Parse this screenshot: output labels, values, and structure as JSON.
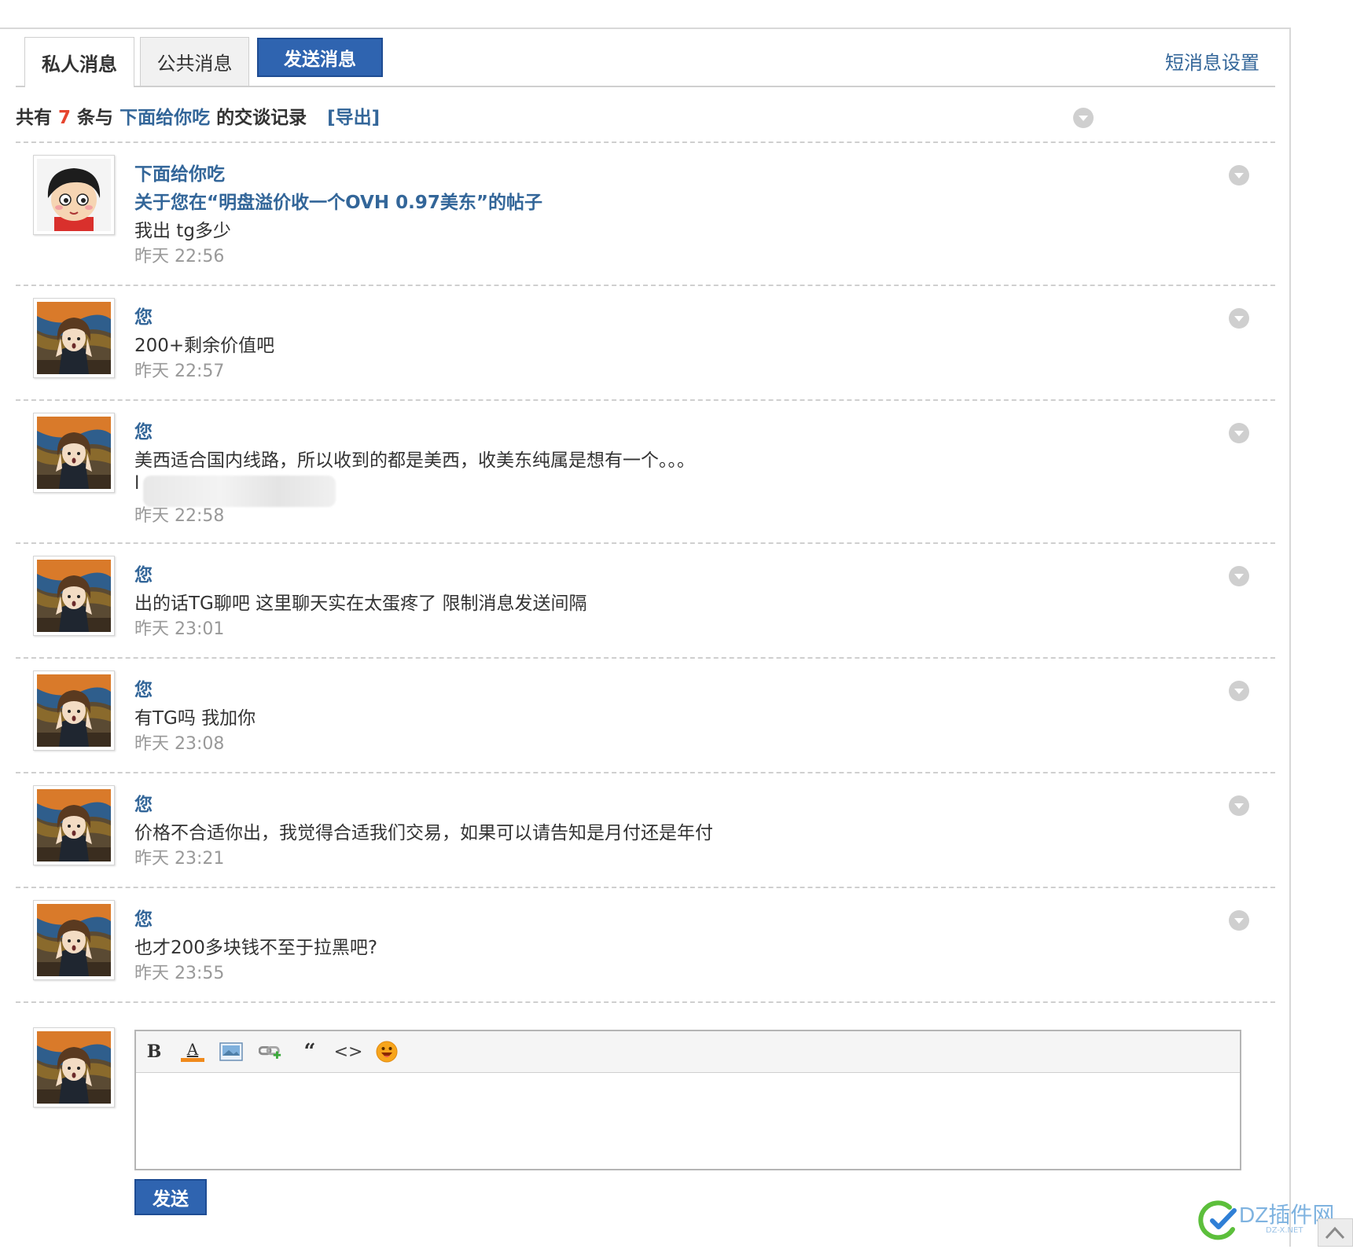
{
  "tabs": {
    "private": "私人消息",
    "public": "公共消息",
    "send_message": "发送消息",
    "settings": "短消息设置"
  },
  "summary": {
    "prefix": "共有",
    "count": "7",
    "middle": "条与",
    "peer": "下面给你吃",
    "suffix": "的交谈记录",
    "export": "[导出]"
  },
  "messages": [
    {
      "author": "下面给你吃",
      "subject": "关于您在“明盘溢价收一个OVH 0.97美东”的帖子",
      "text": "我出 tg多少",
      "time": "昨天 22:56",
      "avatar": "peer"
    },
    {
      "author": "您",
      "text": "200+剩余价值吧",
      "time": "昨天 22:57",
      "avatar": "self"
    },
    {
      "author": "您",
      "text": "美西适合国内线路，所以收到的都是美西，收美东纯属是想有一个。。。",
      "text2": "l",
      "time": "昨天 22:58",
      "avatar": "self"
    },
    {
      "author": "您",
      "text": "出的话TG聊吧 这里聊天实在太蛋疼了 限制消息发送间隔",
      "time": "昨天 23:01",
      "avatar": "self"
    },
    {
      "author": "您",
      "text": "有TG吗 我加你",
      "time": "昨天 23:08",
      "avatar": "self"
    },
    {
      "author": "您",
      "text": "价格不合适你出，我觉得合适我们交易，如果可以请告知是月付还是年付",
      "time": "昨天 23:21",
      "avatar": "self"
    },
    {
      "author": "您",
      "text": "也才200多块钱不至于拉黑吧?",
      "time": "昨天 23:55",
      "avatar": "self"
    }
  ],
  "editor": {
    "toolbar_icons": [
      "bold-icon",
      "font-color-icon",
      "image-icon",
      "link-icon",
      "quote-icon",
      "code-icon",
      "smiley-icon"
    ],
    "bold_glyph": "B",
    "color_glyph": "A",
    "quote_glyph": "“",
    "code_glyph": "<>",
    "value": ""
  },
  "send_button": "发送",
  "watermark": {
    "text": "DZ插件网",
    "sub": "DZ-X.NET"
  },
  "colors": {
    "link": "#336699",
    "button": "#2f64b0",
    "count": "#e6452f",
    "time": "#999999"
  }
}
